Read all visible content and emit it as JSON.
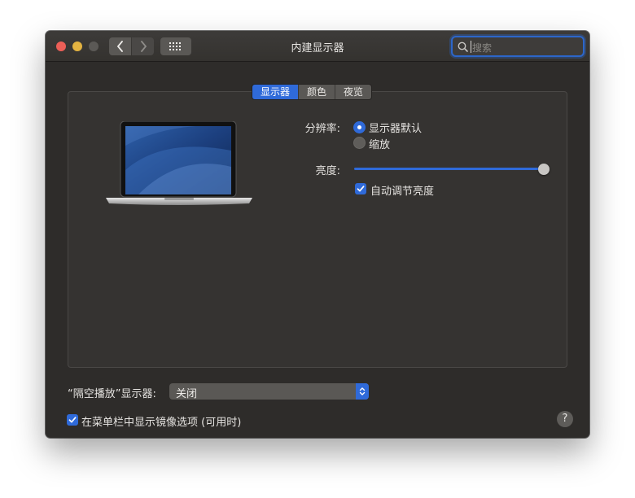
{
  "window": {
    "title": "内建显示器",
    "search_placeholder": "搜索"
  },
  "tabs": [
    {
      "label": "显示器",
      "active": true
    },
    {
      "label": "颜色",
      "active": false
    },
    {
      "label": "夜览",
      "active": false
    }
  ],
  "display": {
    "resolution_label": "分辨率:",
    "resolution_options": [
      {
        "label": "显示器默认",
        "selected": true
      },
      {
        "label": "缩放",
        "selected": false
      }
    ],
    "brightness_label": "亮度:",
    "brightness_level": 1.0,
    "auto_brightness_label": "自动调节亮度",
    "auto_brightness_checked": true
  },
  "airplay": {
    "label": "“隔空播放”显示器:",
    "value": "关闭"
  },
  "mirroring": {
    "label": "在菜单栏中显示镜像选项 (可用时)",
    "checked": true
  },
  "help_label": "?",
  "colors": {
    "accent": "#2f6ad9",
    "window_bg": "#2e2c2a",
    "close": "#ec5f57",
    "minimize": "#e3b341"
  }
}
